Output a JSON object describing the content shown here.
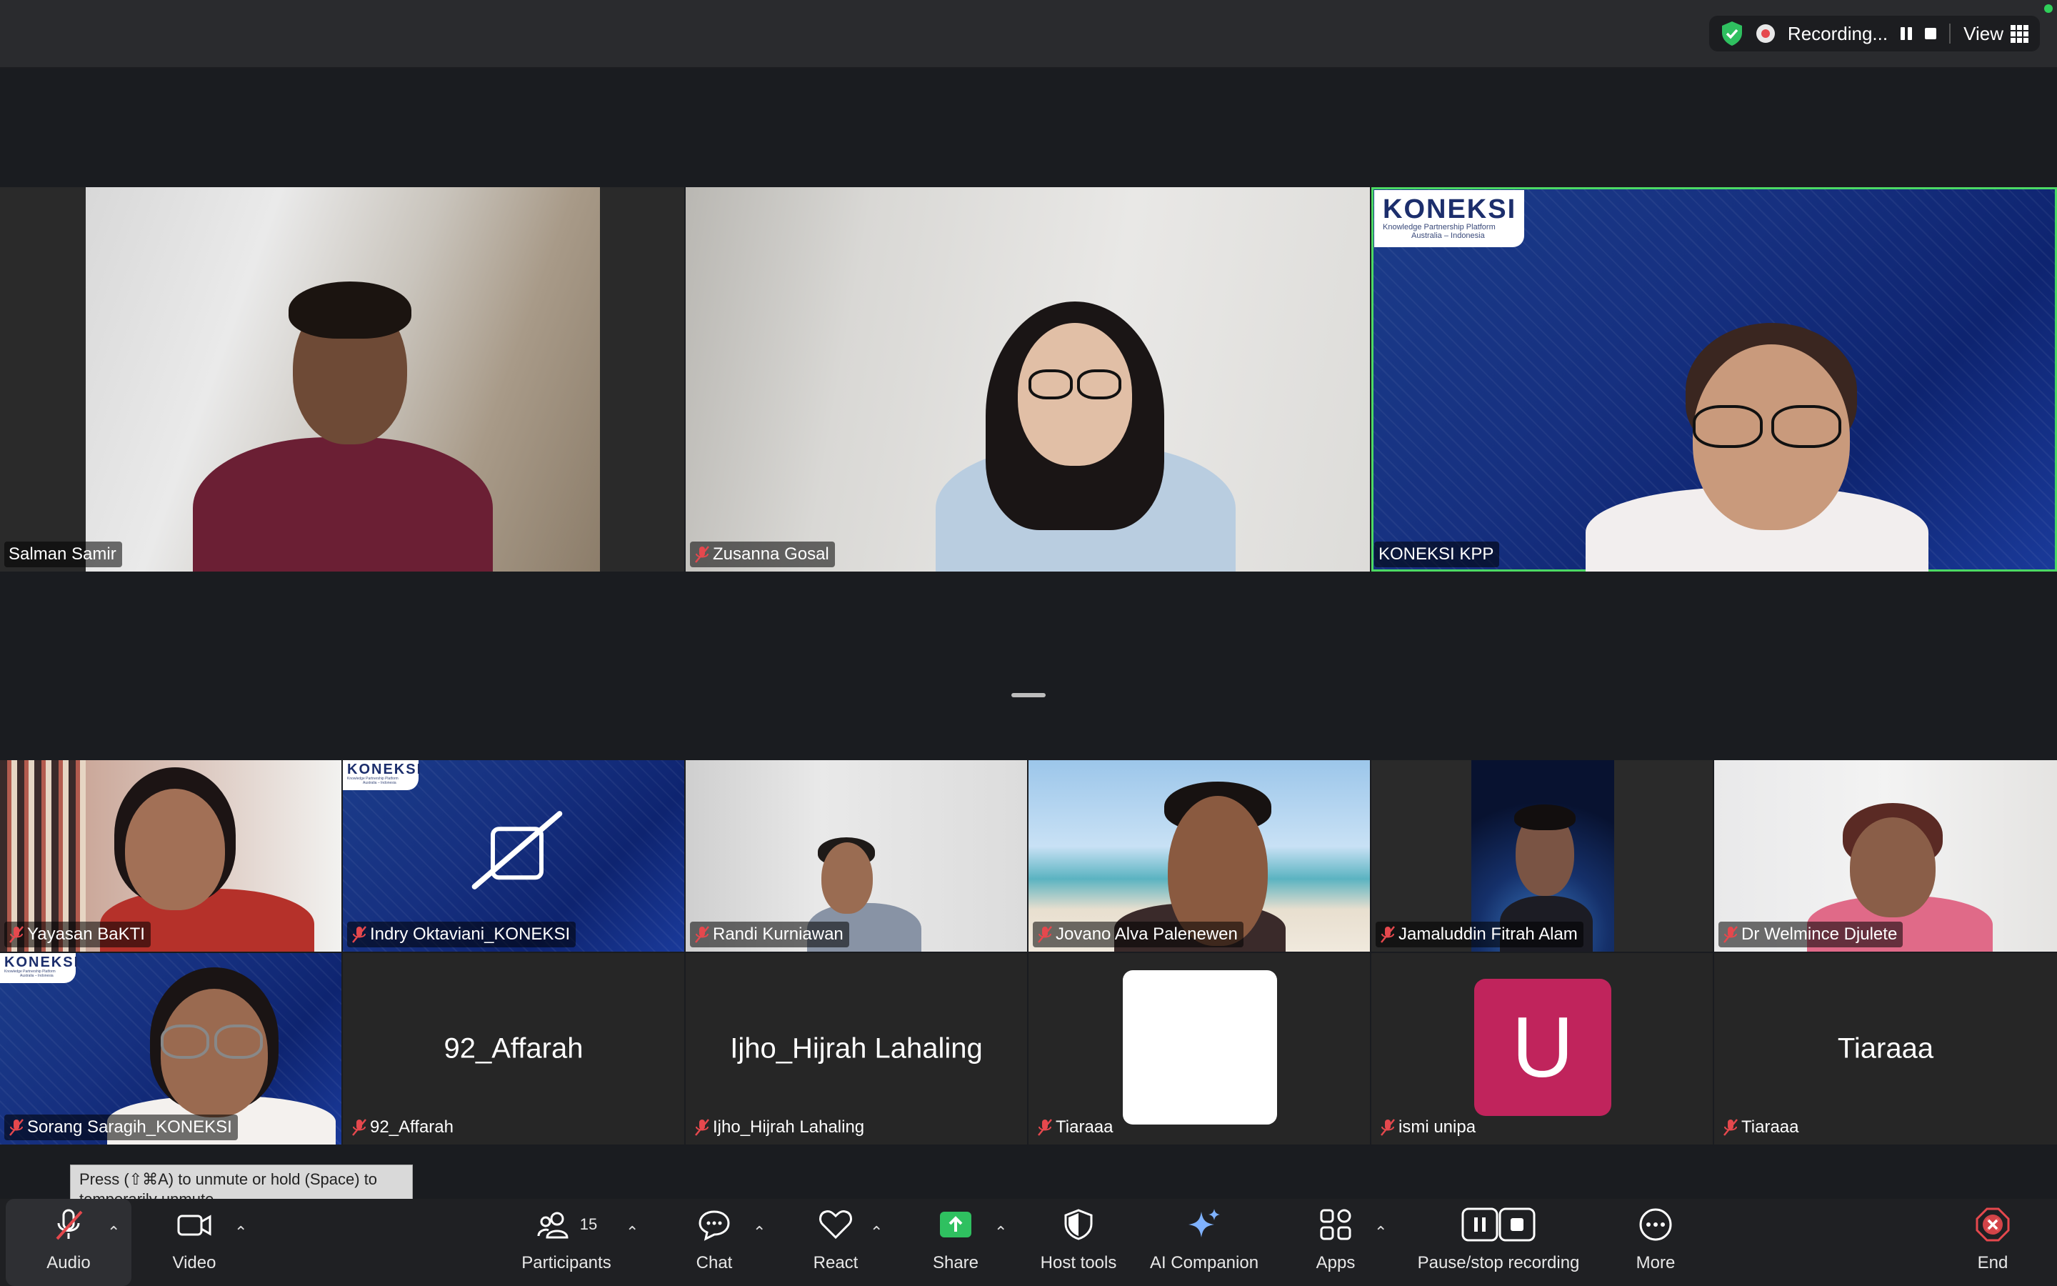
{
  "topbar": {
    "recording_label": "Recording...",
    "view_label": "View"
  },
  "top_row": [
    {
      "name": "Salman Samir",
      "muted": false
    },
    {
      "name": "Zusanna Gosal",
      "muted": true
    },
    {
      "name": "KONEKSI KPP",
      "muted": false,
      "active_speaker": true
    }
  ],
  "koneksi_logo": {
    "brand": "KONEKSI",
    "tagline1": "Knowledge Partnership Platform",
    "tagline2": "Australia – Indonesia"
  },
  "gallery": [
    {
      "name": "Yayasan BaKTI",
      "muted": true
    },
    {
      "name": "Indry Oktaviani_KONEKSI",
      "muted": true
    },
    {
      "name": "Randi Kurniawan",
      "muted": true
    },
    {
      "name": "Jovano Alva Palenewen",
      "muted": true
    },
    {
      "name": "Jamaluddin Fitrah Alam",
      "muted": true
    },
    {
      "name": "Dr Welmince Djulete",
      "muted": true
    },
    {
      "name": "Sorang Saragih_KONEKSI",
      "muted": true
    },
    {
      "name": "92_Affarah",
      "muted": true,
      "center_label": "92_Affarah"
    },
    {
      "name": "Ijho_Hijrah Lahaling",
      "muted": true,
      "center_label": "Ijho_Hijrah Lahaling"
    },
    {
      "name": "Tiaraaa",
      "muted": true
    },
    {
      "name": "ismi unipa",
      "muted": true,
      "avatar_letter": "U",
      "avatar_color": "#c0245c"
    },
    {
      "name": "Tiaraaa",
      "muted": true,
      "center_label": "Tiaraaa"
    }
  ],
  "tooltip": {
    "line1": "Press (⇧⌘A) to unmute or hold (Space) to",
    "line2": "temporarily unmute."
  },
  "toolbar": {
    "audio": "Audio",
    "video": "Video",
    "participants": "Participants",
    "participants_count": "15",
    "chat": "Chat",
    "react": "React",
    "share": "Share",
    "host_tools": "Host tools",
    "ai_companion": "AI Companion",
    "apps": "Apps",
    "pause_stop_recording": "Pause/stop recording",
    "more": "More",
    "end": "End"
  },
  "colors": {
    "share_green": "#2fc060",
    "end_red": "#e5484d",
    "active_speaker_border": "#4cd964"
  }
}
